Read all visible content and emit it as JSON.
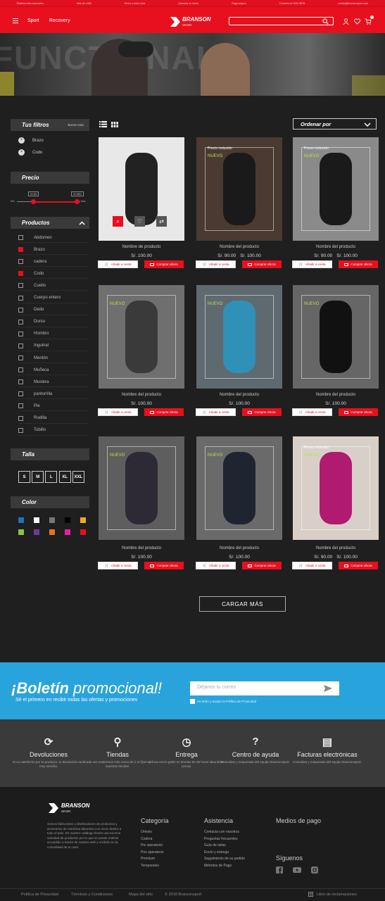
{
  "topbar": {
    "items": [
      "Pedidos internacionales",
      "Más de 1000",
      "Envío a toda Lima",
      "Garantía en todos",
      "Paga seguro",
      "Contacto al 1234 5678",
      "ventas@bransonsport.com"
    ]
  },
  "nav": {
    "links": [
      "Sport",
      "Recovery"
    ],
    "brand": "BRANSON",
    "brand_sub": "SPORT",
    "search_placeholder": "",
    "cart_count": "0"
  },
  "hero": {
    "bg_text": "FUNCTIONAL"
  },
  "sidebar": {
    "filters_title": "Tus filtros",
    "clear_all": "Borrar todo",
    "active_filters": [
      "Brazo",
      "Codo"
    ],
    "price_title": "Precio",
    "price_min": "S/.60",
    "price_max": "S/.300",
    "price_low_label": "Min",
    "price_high_label": "Max",
    "products_title": "Productos",
    "categories": [
      {
        "label": "Abdomen",
        "checked": false
      },
      {
        "label": "Brazo",
        "checked": true
      },
      {
        "label": "cadera",
        "checked": false
      },
      {
        "label": "Codo",
        "checked": true
      },
      {
        "label": "Cuello",
        "checked": false
      },
      {
        "label": "Cuerpo entero",
        "checked": false
      },
      {
        "label": "Dedo",
        "checked": false
      },
      {
        "label": "Dorso",
        "checked": false
      },
      {
        "label": "Hombro",
        "checked": false
      },
      {
        "label": "Inguinal",
        "checked": false
      },
      {
        "label": "Mentón",
        "checked": false
      },
      {
        "label": "Muñeca",
        "checked": false
      },
      {
        "label": "Muslera",
        "checked": false
      },
      {
        "label": "pantorrilla",
        "checked": false
      },
      {
        "label": "Pie",
        "checked": false
      },
      {
        "label": "Rodilla",
        "checked": false
      },
      {
        "label": "Tobillo",
        "checked": false
      }
    ],
    "size_title": "Talla",
    "sizes": [
      "S",
      "M",
      "L",
      "XL",
      "XXL"
    ],
    "color_title": "Color",
    "colors": [
      "#1e73be",
      "#ffffff",
      "#777777",
      "#000000",
      "#f6a623",
      "#8bc34a",
      "#6a3d9a",
      "#e8731e",
      "#e81ea0",
      "#e8101e"
    ]
  },
  "toolbar": {
    "sort_label": "Ordenar por"
  },
  "products": [
    {
      "name": "Nombre de producto",
      "old_price": "",
      "price": "S/. 100.00",
      "badge": "",
      "reduced": ""
    },
    {
      "name": "Nombre del producto",
      "old_price": "S/. 90.00",
      "price": "S/. 100.00",
      "badge": "NUEVO",
      "reduced": "Precio reducido"
    },
    {
      "name": "Nombre del producto",
      "old_price": "S/. 90.00",
      "price": "S/. 100.00",
      "badge": "NUEVO",
      "reduced": "Precio reducido"
    },
    {
      "name": "Nombre del producto",
      "old_price": "",
      "price": "S/. 100.00",
      "badge": "NUEVO",
      "reduced": ""
    },
    {
      "name": "Nombre del producto",
      "old_price": "",
      "price": "S/. 100.00",
      "badge": "NUEVO",
      "reduced": ""
    },
    {
      "name": "Nombre del producto",
      "old_price": "",
      "price": "S/. 100.00",
      "badge": "NUEVO",
      "reduced": ""
    },
    {
      "name": "Nombre del producto",
      "old_price": "",
      "price": "S/. 100.00",
      "badge": "NUEVO",
      "reduced": ""
    },
    {
      "name": "Nombre del producto",
      "old_price": "",
      "price": "S/. 100.00",
      "badge": "NUEVO",
      "reduced": ""
    },
    {
      "name": "Nombre del producto",
      "old_price": "S/. 90.00",
      "price": "S/. 100.00",
      "badge": "NUEVO",
      "reduced": "Precio reducido"
    }
  ],
  "product_actions": {
    "add_cart": "Añadir a cesta",
    "buy_now": "Comprar ahora"
  },
  "load_more": "CARGAR MÁS",
  "newsletter": {
    "title_bold": "¡Boletín",
    "title_light": "promocional!",
    "subtitle": "Sé el primero en recibir todas las ofertas y promociones",
    "placeholder": "Déjanos tu correo",
    "consent": "He leído y acepto la Política de Privacidad"
  },
  "services": [
    {
      "title": "Devoluciones",
      "desc": "Si no satisfecho por tu producto, tu devolución será muy sencilla."
    },
    {
      "title": "Tiendas",
      "desc": "Cada vez estaremos más cerca de ti, te fijamos nuestras tiendas."
    },
    {
      "title": "Entrega",
      "desc": "¡Ahora envío gratis en tiendas de 48 horas laborables (Lima)."
    },
    {
      "title": "Centro de ayuda",
      "desc": "Consultas y respuestas del equipo Bransonsport."
    },
    {
      "title": "Facturas electrónicas",
      "desc": "Consultas y respuestas del equipo Bransonsport."
    }
  ],
  "footer": {
    "brand": "BRANSON",
    "brand_sub": "SPORT",
    "about": "Somos fabricantes y distribuidores de productos y accesorios de medicina deportiva con envío dentro a todo el país. En nuestro catálogo tienes una enorme variedad de productos por lo que se puede realizar un pedido a través de nuestra web y recibirlo en la comodidad de tu casa.",
    "categoria_title": "Categoría",
    "categoria": [
      "Ortesis",
      "Codera",
      "Pie operatorio",
      "Pos operatorio",
      "Premium",
      "Temporales"
    ],
    "asistencia_title": "Asistencia",
    "asistencia": [
      "Contacta con nosotros",
      "Preguntas frecuentes",
      "Guía de tallas",
      "Envío y entrega",
      "Seguimiento de su pedido",
      "Métodos de Pago"
    ],
    "pago_title": "Medios de pago",
    "siguenos_title": "Síguenos",
    "bottom": [
      "Política de Privacidad",
      "Términos y Condiciones",
      "Mapa del sitio",
      "© 2018 Bransonsport"
    ],
    "complaints": "Libro de reclamaciones"
  },
  "colors": {
    "brand_red": "#e8101e",
    "newsletter_blue": "#29a3dc",
    "new_badge": "#b8e04a"
  }
}
